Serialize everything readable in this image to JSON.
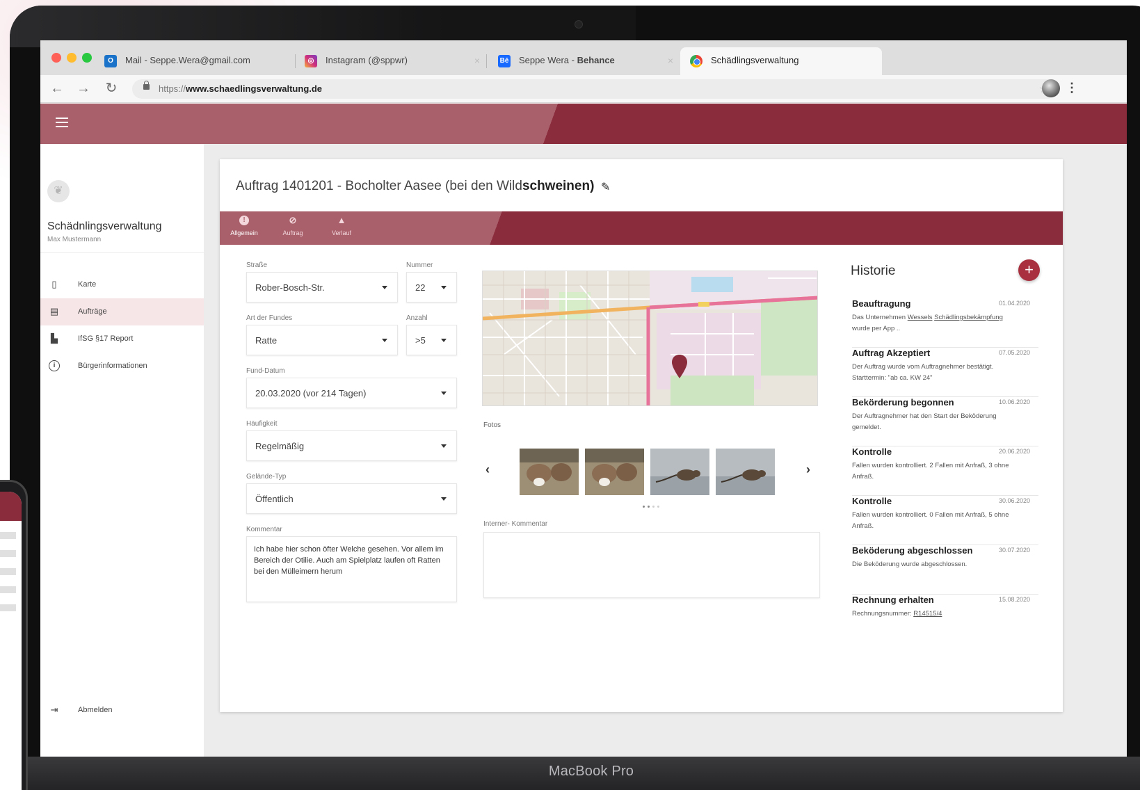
{
  "browser": {
    "tabs": [
      {
        "label_plain": "Mail - Seppe.Wera@gmail.com",
        "label_bold": "",
        "icon": "outlook-icon",
        "active": false
      },
      {
        "label_plain": "Instagram (@sppwr)",
        "label_bold": "",
        "icon": "instagram-icon",
        "active": false
      },
      {
        "label_plain": "Seppe Wera - ",
        "label_bold": "Behance",
        "icon": "behance-icon",
        "active": false
      },
      {
        "label_plain": "Schädlingsverwaltung",
        "label_bold": "",
        "icon": "chrome-icon",
        "active": true
      }
    ],
    "url_prefix": "https://",
    "url_domain": "www.schaedlingsverwaltung.de"
  },
  "sidebar": {
    "app_name": "Schädnlingsverwaltung",
    "user_name": "Max Mustermann",
    "items": [
      {
        "label": "Karte",
        "icon": "map-icon",
        "active": false
      },
      {
        "label": "Aufträge",
        "icon": "document-icon",
        "active": true
      },
      {
        "label": "IfSG §17 Report",
        "icon": "report-icon",
        "active": false
      },
      {
        "label": "Bürgerinformationen",
        "icon": "info-icon",
        "active": false
      }
    ],
    "logout_label": "Abmelden"
  },
  "order": {
    "title_prefix": "Auftrag 1401201 - Bocholter Aasee (bei den Wild",
    "title_bold": "schweinen)",
    "toolbar": [
      {
        "label": "Allgemein",
        "icon": "alert-icon",
        "active": true
      },
      {
        "label": "Auftrag",
        "icon": "paperclip-icon",
        "active": false
      },
      {
        "label": "Verlauf",
        "icon": "bell-icon",
        "active": false
      }
    ],
    "form": {
      "strasse_label": "Straße",
      "strasse_value": "Rober-Bosch-Str.",
      "nummer_label": "Nummer",
      "nummer_value": "22",
      "art_label": "Art der Fundes",
      "art_value": "Ratte",
      "anzahl_label": "Anzahl",
      "anzahl_value": ">5",
      "datum_label": "Fund-Datum",
      "datum_value": "20.03.2020 (vor 214 Tagen)",
      "haeufigkeit_label": "Häufigkeit",
      "haeufigkeit_value": "Regelmäßig",
      "gelaende_label": "Gelände-Typ",
      "gelaende_value": "Öffentlich",
      "kommentar_label": "Kommentar",
      "kommentar_value": "Ich habe hier schon öfter Welche gesehen. Vor allem im Bereich der Otilie. Auch am Spielplatz laufen oft Ratten bei den Mülleimern herum"
    },
    "fotos_label": "Fotos",
    "interner_kommentar_label": "Interner- Kommentar",
    "photo_carousel": {
      "visible_photos": 4,
      "pages": 4,
      "current_page": 2
    }
  },
  "history": {
    "title": "Historie",
    "entries": [
      {
        "title": "Beauftragung",
        "date": "01.04.2020",
        "text_prefix": "Das Unternehmen ",
        "link1": "Wessels",
        "text_mid": " ",
        "link2": "Schädlingsbekämpfung",
        "text_suffix": " wurde per App .."
      },
      {
        "title": "Auftrag Akzeptiert",
        "date": "07.05.2020",
        "text": "Der Auftrag wurde vom Auftragnehmer bestätigt. Starttermin: \"ab ca. KW 24\""
      },
      {
        "title": "Bekörderung begonnen",
        "date": "10.06.2020",
        "text": "Der Auftragnehmer hat den Start der Beköderung gemeldet."
      },
      {
        "title": "Kontrolle",
        "date": "20.06.2020",
        "text": "Fallen wurden kontrolliert. 2 Fallen mit Anfraß, 3 ohne Anfraß."
      },
      {
        "title": "Kontrolle",
        "date": "30.06.2020",
        "text": "Fallen wurden kontrolliert. 0 Fallen mit Anfraß, 5 ohne Anfraß."
      },
      {
        "title": "Beköderung abgeschlossen",
        "date": "30.07.2020",
        "text": "Die Beköderung wurde abgeschlossen."
      },
      {
        "title": "Rechnung erhalten",
        "date": "15.08.2020",
        "text_prefix": "Rechnungsnummer: ",
        "link1": "R14515/4"
      }
    ]
  },
  "device_label": "MacBook Pro",
  "colors": {
    "brand": "#8b2c3c",
    "brand_light": "#a9606b",
    "accent_button": "#a8303f",
    "active_nav_bg": "#f7e6e8"
  }
}
